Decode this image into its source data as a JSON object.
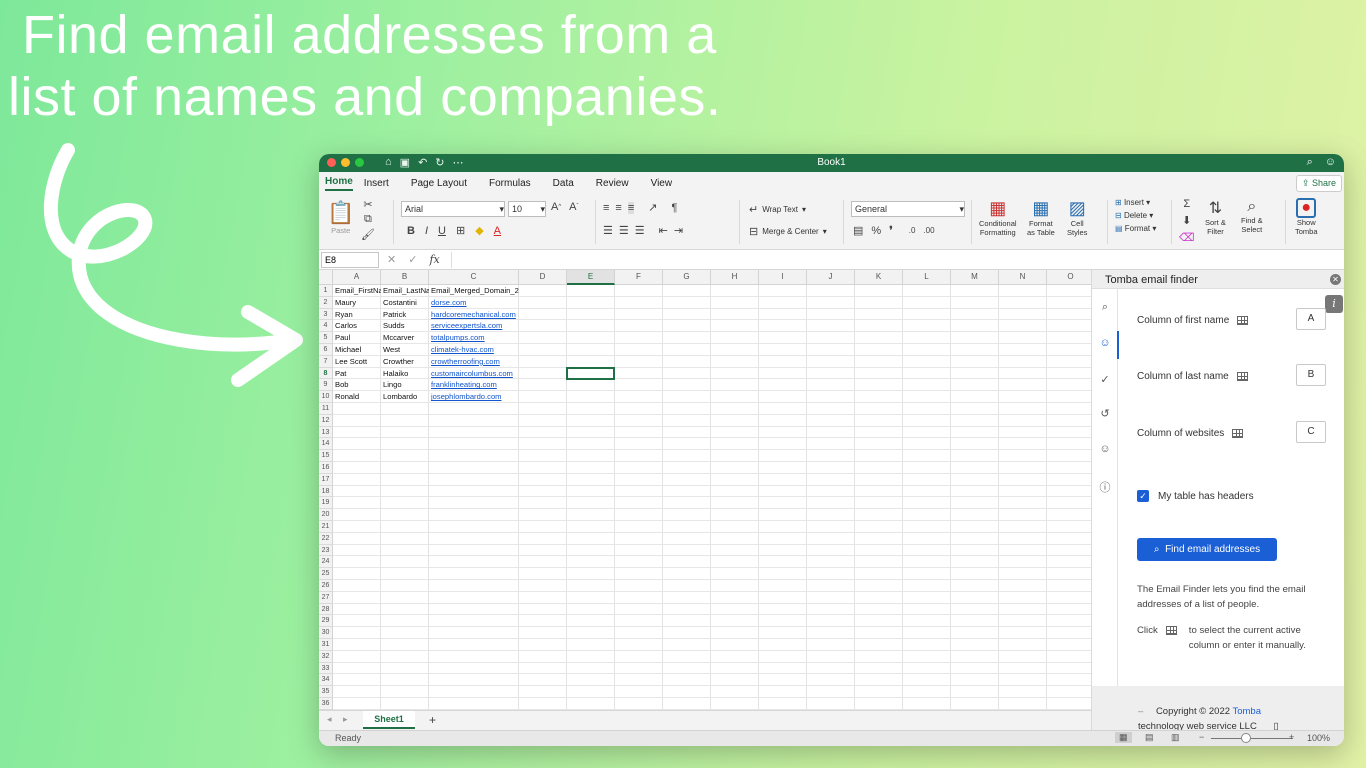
{
  "headline": {
    "line1": "Find email addresses from a",
    "line2": "list of names and companies."
  },
  "window": {
    "title": "Book1",
    "tabs": [
      "Home",
      "Insert",
      "Page Layout",
      "Formulas",
      "Data",
      "Review",
      "View"
    ],
    "active_tab": "Home",
    "share_label": "Share"
  },
  "ribbon": {
    "paste_label": "Paste",
    "font_name": "Arial",
    "font_size": "10",
    "bold": "B",
    "italic": "I",
    "underline": "U",
    "wrap_text": "Wrap Text",
    "merge_center": "Merge & Center",
    "number_format": "General",
    "percent": "%",
    "conditional_formatting": [
      "Conditional",
      "Formatting"
    ],
    "format_as_table": [
      "Format",
      "as Table"
    ],
    "cell_styles": [
      "Cell",
      "Styles"
    ],
    "insert": "Insert",
    "delete": "Delete",
    "format": "Format",
    "sort_filter": [
      "Sort &",
      "Filter"
    ],
    "find_select": [
      "Find &",
      "Select"
    ],
    "show_tomba": [
      "Show",
      "Tomba"
    ]
  },
  "formula_bar": {
    "name_box": "E8",
    "fx": "fx",
    "value": ""
  },
  "sheet": {
    "columns": [
      "A",
      "B",
      "C",
      "D",
      "E",
      "F",
      "G",
      "H",
      "I",
      "J",
      "K",
      "L",
      "M",
      "N",
      "O"
    ],
    "selected_column": "E",
    "selected_row": 8,
    "row_count": 36,
    "rows": [
      [
        "Email_FirstName",
        "Email_LastName",
        "Email_Merged_Domain_2"
      ],
      [
        "Maury",
        "Costantini",
        "dorse.com"
      ],
      [
        "Ryan",
        "Patrick",
        "hardcoremechanical.com"
      ],
      [
        "Carlos",
        "Sudds",
        "serviceexpertsla.com"
      ],
      [
        "Paul",
        "Mccarver",
        "totalpumps.com"
      ],
      [
        "Michael",
        "West",
        "climatek-hvac.com"
      ],
      [
        "Lee Scott",
        "Crowther",
        "crowtherroofing.com"
      ],
      [
        "Pat",
        "Halaiko",
        "customaircolumbus.com"
      ],
      [
        "Bob",
        "Lingo",
        "franklinheating.com"
      ],
      [
        "Ronald",
        "Lombardo",
        "josephlombardo.com"
      ]
    ],
    "sheet_tab": "Sheet1",
    "add_sheet": "+"
  },
  "status": {
    "ready": "Ready",
    "zoom": "100%",
    "minus": "−",
    "plus": "+"
  },
  "panel": {
    "title": "Tomba email finder",
    "first_name_label": "Column of first name",
    "first_name_value": "A",
    "last_name_label": "Column of last name",
    "last_name_value": "B",
    "websites_label": "Column of websites",
    "websites_value": "C",
    "headers_label": "My table has headers",
    "headers_checked": true,
    "find_button": "Find email addresses",
    "desc1": "The Email Finder lets you find the email addresses of a list of people.",
    "click_word": "Click",
    "desc2": "to select the current active column or enter it manually.",
    "footer_prefix": "–",
    "footer_copyright": "Copyright © 2022",
    "footer_brand": "Tomba",
    "footer_rest": "technology web service LLC",
    "info_badge": "i"
  },
  "colors": {
    "excel_green": "#1f7145",
    "accent_blue": "#1a5fd6",
    "link_blue": "#1155cc"
  }
}
